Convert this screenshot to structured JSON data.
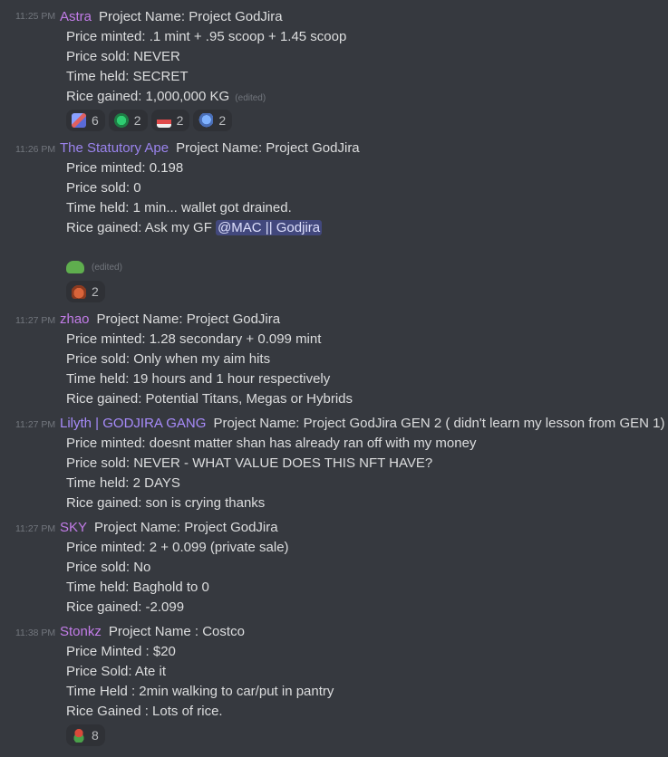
{
  "messages": [
    {
      "time": "11:25 PM",
      "author": "Astra",
      "author_color": "#c27ce8",
      "first_line": "Project Name: Project GodJira",
      "lines": [
        "Price minted:  .1 mint + .95 scoop + 1.45 scoop",
        "Price sold: NEVER",
        "Time held: SECRET",
        "Rice gained: 1,000,000 KG"
      ],
      "edited": "(edited)",
      "reactions": [
        {
          "icon": "rocket-emoji-icon",
          "count": "6"
        },
        {
          "icon": "green-dino-emoji-icon",
          "count": "2"
        },
        {
          "icon": "sneaker-emoji-icon",
          "count": "2"
        },
        {
          "icon": "blue-dino-emoji-icon",
          "count": "2"
        }
      ]
    },
    {
      "time": "11:26 PM",
      "author": "The Statutory Ape",
      "author_color": "#9b84ee",
      "first_line": "Project Name: Project GodJira",
      "lines": [
        "Price minted:  0.198",
        "Price sold: 0",
        "Time held: 1 min... wallet got drained.",
        "Rice gained: Ask my GF"
      ],
      "mention": "@MAC || Godjira",
      "edited": "(edited)",
      "reactions": [
        {
          "icon": "face-emoji-icon",
          "count": "2"
        }
      ]
    },
    {
      "time": "11:27 PM",
      "author": "zhao",
      "author_color": "#c27ce8",
      "first_line": "Project Name: Project GodJira",
      "lines": [
        "Price minted:  1.28 secondary + 0.099 mint",
        "Price sold: Only when my aim hits",
        "Time held: 19 hours and 1 hour respectively",
        "Rice gained: Potential Titans, Megas or Hybrids"
      ]
    },
    {
      "time": "11:27 PM",
      "author": "Lilyth | GODJIRA GANG",
      "author_color": "#a78bfa",
      "first_line": "Project Name: Project GodJira GEN 2 ( didn't learn my lesson from GEN 1)",
      "lines": [
        "Price minted:  doesnt matter shan has already ran off with my money",
        "Price sold: NEVER - WHAT VALUE DOES THIS  NFT HAVE?",
        "Time held: 2 DAYS",
        "Rice gained: son  is crying thanks"
      ]
    },
    {
      "time": "11:27 PM",
      "author": "SKY",
      "author_color": "#c27ce8",
      "first_line": "Project Name: Project GodJira",
      "lines": [
        "Price minted:  2 + 0.099 (private sale)",
        "Price sold: No",
        "Time held: Baghold to 0",
        "Rice gained: -2.099"
      ]
    },
    {
      "time": "11:38 PM",
      "author": "Stonkz",
      "author_color": "#c27ce8",
      "first_line": "Project Name : Costco",
      "lines": [
        "Price Minted : $20",
        "Price Sold: Ate it",
        "Time Held : 2min walking to car/put in pantry",
        "Rice Gained : Lots of rice."
      ],
      "reactions": [
        {
          "icon": "pepe-emoji-icon",
          "count": "8"
        }
      ]
    }
  ]
}
